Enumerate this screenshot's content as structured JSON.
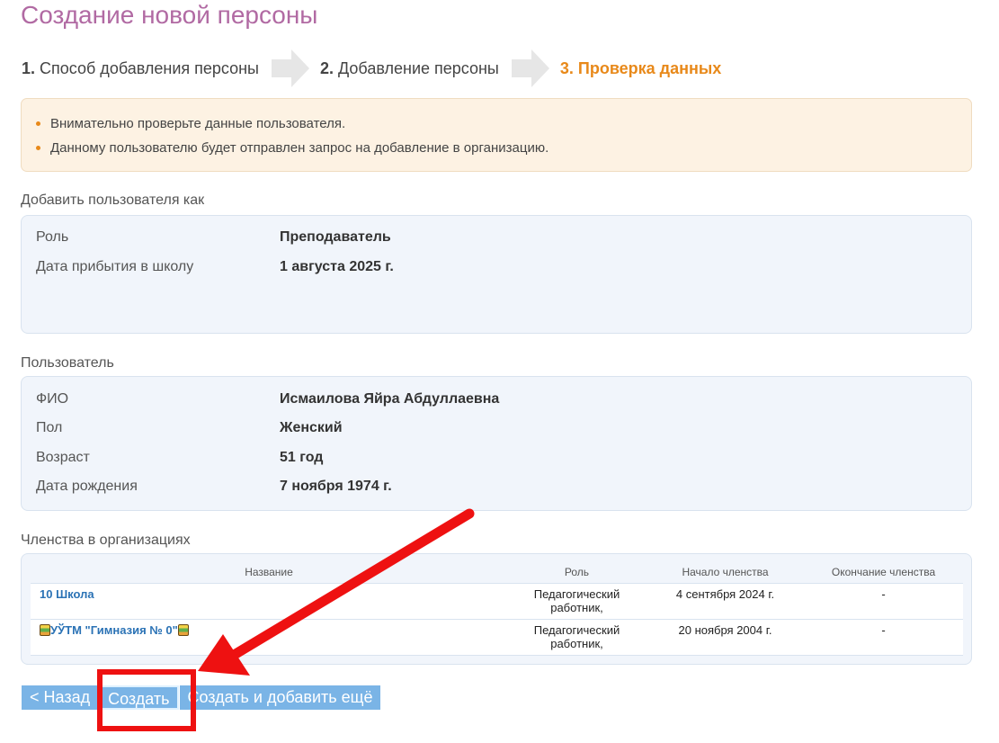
{
  "page": {
    "title": "Создание новой персоны"
  },
  "steps": [
    {
      "num": "1.",
      "label": "Способ добавления персоны"
    },
    {
      "num": "2.",
      "label": "Добавление персоны"
    },
    {
      "label": "3. Проверка данных"
    }
  ],
  "notice": [
    "Внимательно проверьте данные пользователя.",
    "Данному пользователю будет отправлен запрос на добавление в организацию."
  ],
  "add_as": {
    "heading": "Добавить пользователя как",
    "role_label": "Роль",
    "role_value": "Преподаватель",
    "arrival_label": "Дата прибытия в школу",
    "arrival_value": "1 августа 2025 г."
  },
  "user": {
    "heading": "Пользователь",
    "fio_label": "ФИО",
    "fio_value": "Исмаилова Яйра Абдуллаевна",
    "gender_label": "Пол",
    "gender_value": "Женский",
    "age_label": "Возраст",
    "age_value": "51 год",
    "birth_label": "Дата рождения",
    "birth_value": "7 ноября 1974 г."
  },
  "memberships": {
    "heading": "Членства в организациях",
    "columns": [
      "Название",
      "Роль",
      "Начало членства",
      "Окончание членства"
    ],
    "rows": [
      {
        "name": "10 Школа",
        "role": "Педагогический работник,",
        "start": "4 сентября 2024 г.",
        "end": "-"
      },
      {
        "name": "УЎТМ \"Гимназия № 0\"",
        "role": "Педагогический работник,",
        "start": "20 ноября 2004 г.",
        "end": "-"
      }
    ]
  },
  "buttons": {
    "back": "< Назад",
    "create": "Создать",
    "create_more": "Создать и добавить ещё"
  },
  "colors": {
    "title": "#b16aa3",
    "active_step": "#e8891a",
    "button": "#7ab4e6",
    "annotation": "#ee1111"
  }
}
